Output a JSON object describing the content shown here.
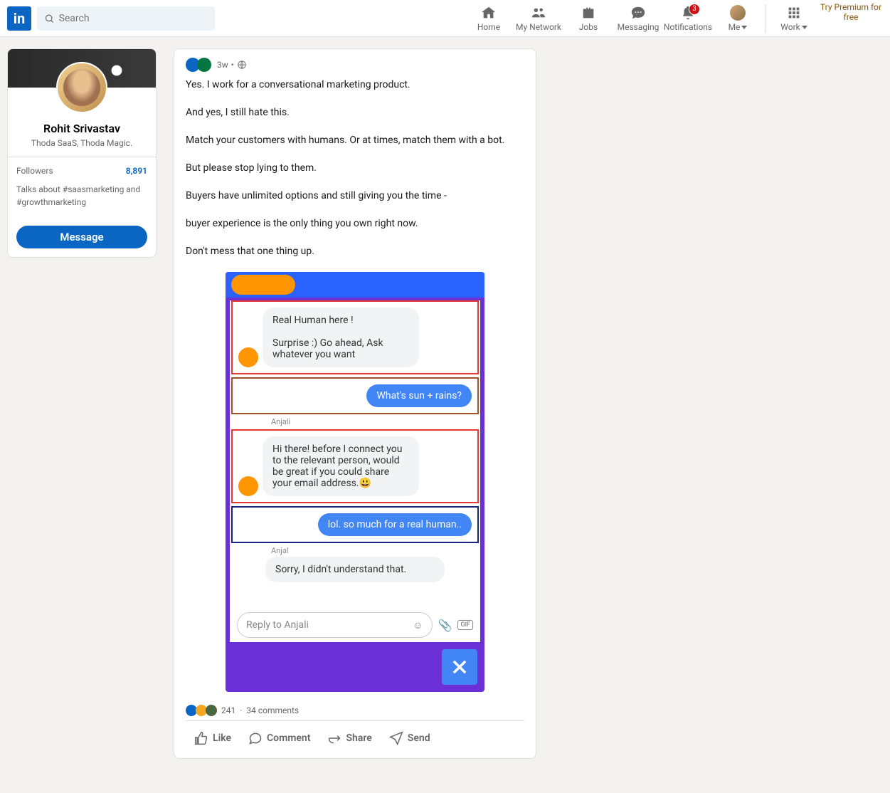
{
  "header": {
    "search_placeholder": "Search",
    "nav": {
      "home": "Home",
      "network": "My Network",
      "jobs": "Jobs",
      "messaging": "Messaging",
      "notifications": "Notifications",
      "notif_badge": "3",
      "me": "Me",
      "work": "Work",
      "premium": "Try Premium for free"
    }
  },
  "profile": {
    "name": "Rohit Srivastav",
    "tagline": "Thoda SaaS, Thoda Magic.",
    "followers_label": "Followers",
    "followers_count": "8,891",
    "talks_about": "Talks about #saasmarketing and #growthmarketing",
    "message_btn": "Message"
  },
  "post": {
    "meta_time": "3w",
    "body": [
      "Yes. I work for a conversational marketing product.",
      "And yes, I still hate this.",
      "Match your customers with humans. Or at times, match them with a bot.",
      "But please stop lying to them.",
      "Buyers have unlimited options and still giving you the time -",
      "buyer experience is the only thing you own right now.",
      "Don't mess that one thing up."
    ],
    "chat": {
      "m1": "Real Human here !\n\nSurprise :) Go ahead, Ask whatever you want",
      "m2": "What's sun + rains?",
      "name": "Anjali",
      "m3": "Hi there! before I connect you to the relevant person, would be great if you could share your email address.😃",
      "m4": "lol. so much for a real human..",
      "name2": "Anjal",
      "m5": "Sorry, I didn't understand that.",
      "input_placeholder": "Reply to Anjali",
      "gif": "GIF"
    },
    "engagement": {
      "reactions": "241",
      "comments": "34 comments"
    },
    "actions": {
      "like": "Like",
      "comment": "Comment",
      "share": "Share",
      "send": "Send"
    }
  }
}
